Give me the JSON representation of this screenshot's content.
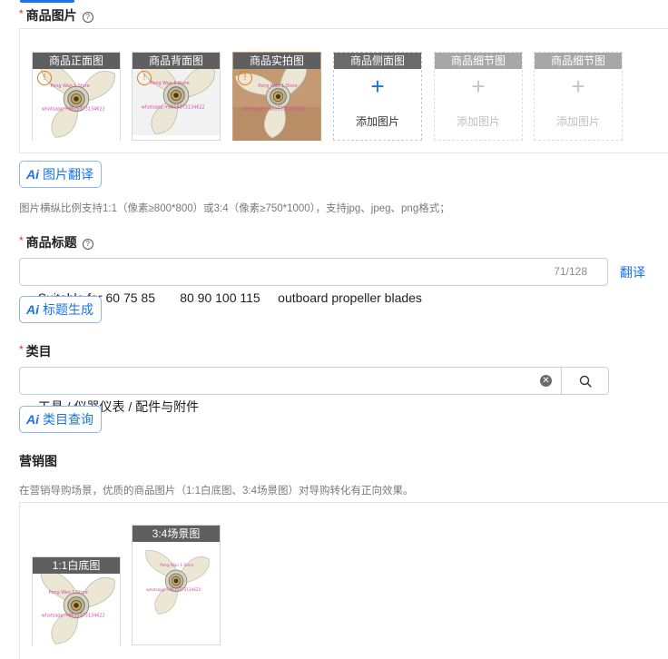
{
  "images_section": {
    "label": "商品图片",
    "slots": [
      {
        "caption": "商品正面图",
        "state": "filled",
        "style": "white"
      },
      {
        "caption": "商品背面图",
        "state": "filled",
        "style": "back"
      },
      {
        "caption": "商品实拍图",
        "state": "filled",
        "style": "photo"
      },
      {
        "caption": "商品侧面图",
        "state": "empty",
        "add_label": "添加图片"
      },
      {
        "caption": "商品细节图",
        "state": "disabled",
        "add_label": "添加图片"
      },
      {
        "caption": "商品细节图",
        "state": "disabled",
        "add_label": "添加图片"
      }
    ],
    "watermark_top": "Peng Wan 1 Store",
    "watermark_bottom": "whatsapp:+8615373134622",
    "translate_button": "图片翻译",
    "hint": "图片横纵比例支持1:1（像素≥800*800）或3:4（像素≥750*1000），支持jpg、jpeg、png格式；"
  },
  "title_section": {
    "label": "商品标题",
    "value": "Suitable for 60 75 85       80 90 100 115     outboard propeller blades",
    "counter": "71/128",
    "translate_link": "翻译",
    "generate_button": "标题生成"
  },
  "category_section": {
    "label": "类目",
    "value": "工具 / 仪器仪表 / 配件与附件",
    "query_button": "类目查询"
  },
  "marketing_section": {
    "label": "营销图",
    "hint": "在营销导购场景，优质的商品图片（1:1白底图、3:4场景图）对导购转化有正向效果。",
    "slots": [
      {
        "caption": "1:1白底图"
      },
      {
        "caption": "3:4场景图"
      }
    ]
  },
  "colors": {
    "accent": "#1a73e8",
    "required": "#e0301e",
    "propeller": "#ece8d6"
  }
}
